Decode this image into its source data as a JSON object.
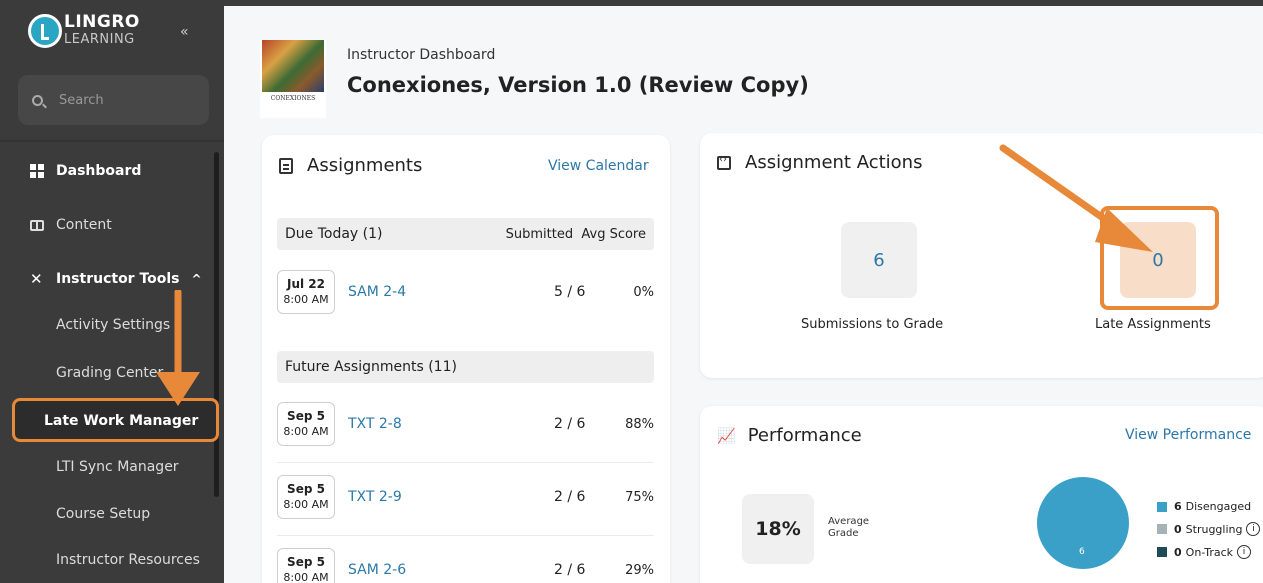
{
  "sidebar": {
    "logo_line1": "LINGRO",
    "logo_line2": "LEARNING",
    "collapse_icon": "«",
    "search_placeholder": "Search",
    "items": [
      {
        "label": "Dashboard"
      },
      {
        "label": "Content"
      },
      {
        "label": "Instructor Tools"
      }
    ],
    "instructor_tools_chevron": "^",
    "sub_items": [
      {
        "label": "Activity Settings"
      },
      {
        "label": "Grading Center"
      },
      {
        "label": "Late Work Manager"
      },
      {
        "label": "LTI Sync Manager"
      },
      {
        "label": "Course Setup"
      },
      {
        "label": "Instructor Resources"
      }
    ]
  },
  "header": {
    "subtitle": "Instructor Dashboard",
    "title": "Conexiones, Version 1.0 (Review Copy)",
    "book_cover_text": "CONEXIONES"
  },
  "assignments": {
    "title": "Assignments",
    "view_calendar": "View Calendar",
    "due_today_label": "Due Today",
    "due_today_count": "(1)",
    "col_submitted": "Submitted",
    "col_avg": "Avg Score",
    "future_label": "Future Assignments",
    "future_count": "(11)",
    "rows": [
      {
        "date": "Jul 22",
        "time": "8:00 AM",
        "name": "SAM 2-4",
        "submitted": "5 / 6",
        "avg": "0%"
      },
      {
        "date": "Sep 5",
        "time": "8:00 AM",
        "name": "TXT 2-8",
        "submitted": "2 / 6",
        "avg": "88%"
      },
      {
        "date": "Sep 5",
        "time": "8:00 AM",
        "name": "TXT 2-9",
        "submitted": "2 / 6",
        "avg": "75%"
      },
      {
        "date": "Sep 5",
        "time": "8:00 AM",
        "name": "SAM 2-6",
        "submitted": "2 / 6",
        "avg": "29%"
      }
    ]
  },
  "actions": {
    "title": "Assignment Actions",
    "submissions_value": "6",
    "submissions_label": "Submissions to Grade",
    "late_value": "0",
    "late_label": "Late Assignments"
  },
  "performance": {
    "title": "Performance",
    "view_link": "View Performance",
    "average_value": "18%",
    "average_label": "Average Grade",
    "pie_label": "6",
    "legend": [
      {
        "count": "6",
        "label": "Disengaged",
        "color": "#3aa0c8",
        "info": ""
      },
      {
        "count": "0",
        "label": "Struggling",
        "color": "#a7b2b7",
        "info": "i"
      },
      {
        "count": "0",
        "label": "On-Track",
        "color": "#1f4a5a",
        "info": "i"
      }
    ]
  },
  "colors": {
    "highlight": "#e8893a",
    "link": "#2c78a8",
    "sidebar": "#3b3b3b"
  }
}
